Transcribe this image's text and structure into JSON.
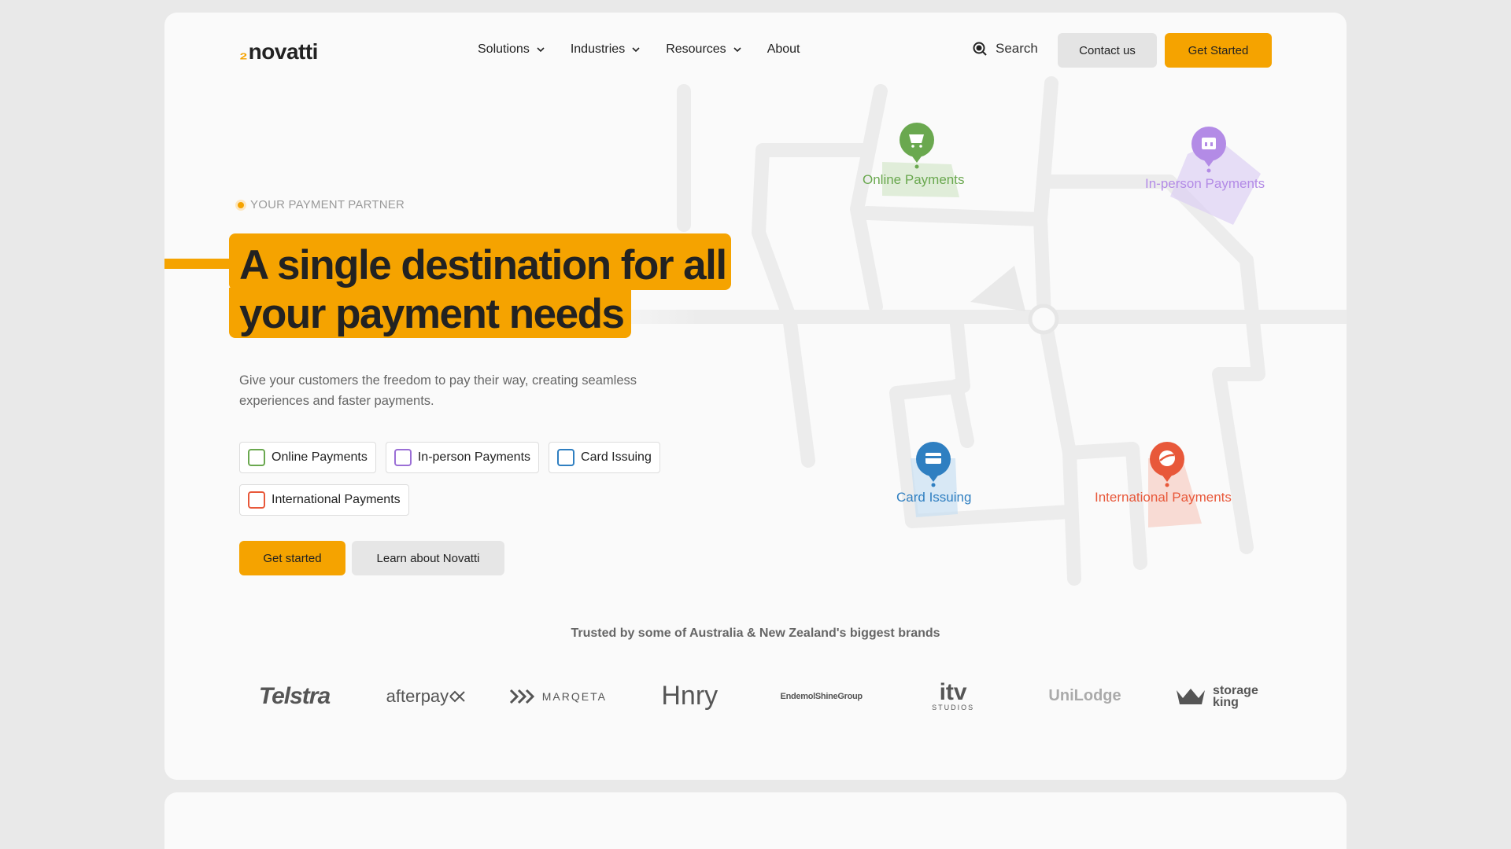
{
  "header": {
    "logo_mark": "₂",
    "logo_text": "novatti",
    "nav": [
      {
        "label": "Solutions",
        "has_dropdown": true
      },
      {
        "label": "Industries",
        "has_dropdown": true
      },
      {
        "label": "Resources",
        "has_dropdown": true
      },
      {
        "label": "About",
        "has_dropdown": false
      }
    ],
    "search_label": "Search",
    "contact_label": "Contact us",
    "get_started_label": "Get Started"
  },
  "hero": {
    "eyebrow": "YOUR PAYMENT PARTNER",
    "headline": "A single destination for all your payment needs",
    "subtext": "Give your customers the freedom to pay their way, creating seamless experiences and faster payments.",
    "chips": [
      {
        "label": "Online Payments",
        "color": "#6aa84f"
      },
      {
        "label": "In-person Payments",
        "color": "#9b6fd6"
      },
      {
        "label": "Card Issuing",
        "color": "#2f7fc1"
      },
      {
        "label": "International Payments",
        "color": "#e8583a"
      }
    ],
    "primary_cta": "Get started",
    "secondary_cta": "Learn about Novatti"
  },
  "map": {
    "pins": [
      {
        "label": "Online Payments",
        "color": "#6aa84f",
        "icon": "cart-icon"
      },
      {
        "label": "In-person Payments",
        "color": "#b38be6",
        "icon": "store-icon"
      },
      {
        "label": "Card Issuing",
        "color": "#2f7fc1",
        "icon": "card-icon"
      },
      {
        "label": "International Payments",
        "color": "#e8583a",
        "icon": "globe-icon"
      }
    ]
  },
  "trusted": {
    "heading": "Trusted by some of Australia & New Zealand's biggest brands",
    "brands": [
      {
        "name": "Telstra",
        "display": "Telstra"
      },
      {
        "name": "afterpay",
        "display": "afterpay"
      },
      {
        "name": "MARQETA",
        "display": "MARQETA"
      },
      {
        "name": "Hnry",
        "display": "Hnry"
      },
      {
        "name": "EndemolShineGroup",
        "display": "EndemolShineGroup"
      },
      {
        "name": "itv studios",
        "display_1": "itv",
        "display_2": "STUDIOS"
      },
      {
        "name": "UniLodge",
        "display": "UniLodge"
      },
      {
        "name": "storage king",
        "display_1": "storage",
        "display_2": "king"
      }
    ]
  }
}
